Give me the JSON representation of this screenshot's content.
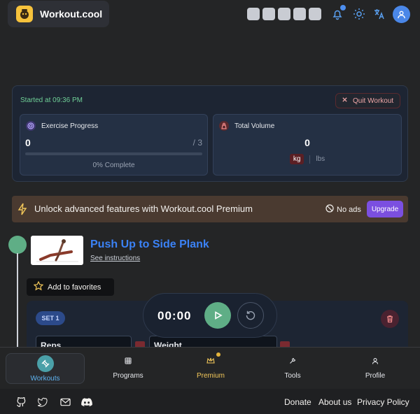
{
  "brand": {
    "name": "Workout.cool",
    "logo_icon": "kettlebell-icon"
  },
  "header": {
    "icons": [
      "bell-icon",
      "sun-icon",
      "translate-icon",
      "user-icon"
    ],
    "notification_color": "#4d8ff0"
  },
  "session": {
    "started_label": "Started at 09:36 PM",
    "quit_label": "Quit Workout",
    "progress": {
      "title": "Exercise Progress",
      "value": "0",
      "total": "/ 3",
      "fraction": 0,
      "percent_label": "0% Complete"
    },
    "volume": {
      "title": "Total Volume",
      "value": "0",
      "unit_kg": "kg",
      "unit_lbs": "lbs"
    }
  },
  "banner": {
    "text": "Unlock advanced features with Workout.cool Premium",
    "noads": "No ads",
    "upgrade": "Upgrade"
  },
  "exercise": {
    "title": "Push Up to Side Plank",
    "instructions": "See instructions",
    "favorite": "Add to favorites",
    "set_label": "SET 1",
    "field1": "Reps",
    "field2": "Weight"
  },
  "timer": {
    "time": "00:00"
  },
  "nav": {
    "items": [
      {
        "label": "Workouts",
        "icon": "dumbbell-icon"
      },
      {
        "label": "Programs",
        "icon": "grid-icon"
      },
      {
        "label": "Premium",
        "icon": "crown-icon"
      },
      {
        "label": "Tools",
        "icon": "wrench-icon"
      },
      {
        "label": "Profile",
        "icon": "user-icon"
      }
    ]
  },
  "footer": {
    "icons": [
      "github-icon",
      "twitter-icon",
      "mail-icon",
      "discord-icon"
    ],
    "links": [
      "Donate",
      "About us",
      "Privacy Policy"
    ]
  },
  "colors": {
    "accent": "#5fae86",
    "link": "#3b82f6",
    "upgrade": "#7b4fe0",
    "premium": "#f3c85a"
  }
}
